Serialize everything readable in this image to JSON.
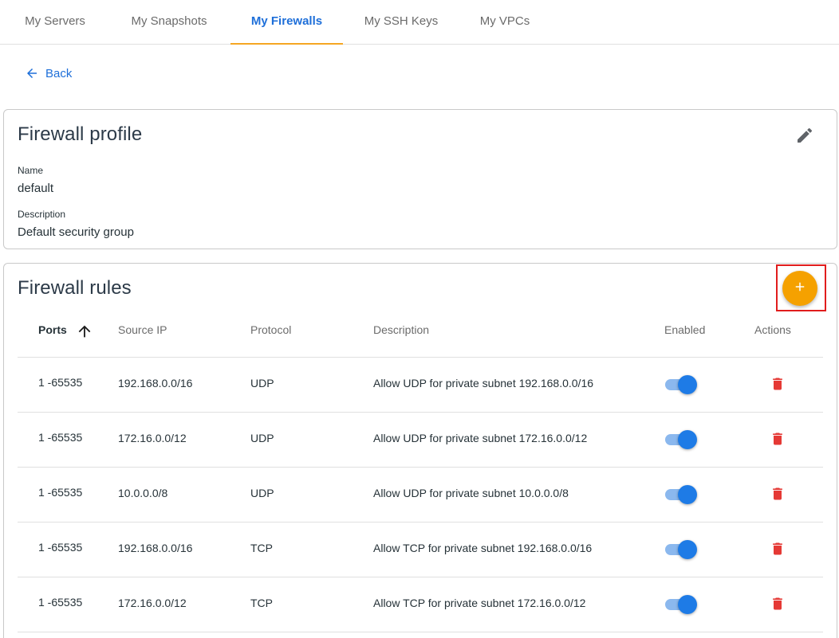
{
  "tabs": [
    {
      "label": "My Servers",
      "active": false
    },
    {
      "label": "My Snapshots",
      "active": false
    },
    {
      "label": "My Firewalls",
      "active": true
    },
    {
      "label": "My SSH Keys",
      "active": false
    },
    {
      "label": "My VPCs",
      "active": false
    }
  ],
  "back": {
    "label": "Back",
    "icon": "arrow-left-icon"
  },
  "profile": {
    "title": "Firewall profile",
    "edit_icon": "pencil-icon",
    "name_label": "Name",
    "name_value": "default",
    "description_label": "Description",
    "description_value": "Default security group"
  },
  "rules": {
    "title": "Firewall rules",
    "add_icon": "plus-icon",
    "columns": {
      "ports": "Ports",
      "source_ip": "Source IP",
      "protocol": "Protocol",
      "description": "Description",
      "enabled": "Enabled",
      "actions": "Actions"
    },
    "sort": {
      "column": "ports",
      "direction": "ascending",
      "icon": "arrow-up-icon"
    },
    "rows": [
      {
        "ports": "1 -65535",
        "source_ip": "192.168.0.0/16",
        "protocol": "UDP",
        "description": "Allow UDP for private subnet 192.168.0.0/16",
        "enabled": true
      },
      {
        "ports": "1 -65535",
        "source_ip": "172.16.0.0/12",
        "protocol": "UDP",
        "description": "Allow UDP for private subnet 172.16.0.0/12",
        "enabled": true
      },
      {
        "ports": "1 -65535",
        "source_ip": "10.0.0.0/8",
        "protocol": "UDP",
        "description": "Allow UDP for private subnet 10.0.0.0/8",
        "enabled": true
      },
      {
        "ports": "1 -65535",
        "source_ip": "192.168.0.0/16",
        "protocol": "TCP",
        "description": "Allow TCP for private subnet 192.168.0.0/16",
        "enabled": true
      },
      {
        "ports": "1 -65535",
        "source_ip": "172.16.0.0/12",
        "protocol": "TCP",
        "description": "Allow TCP for private subnet 172.16.0.0/12",
        "enabled": true
      }
    ],
    "delete_icon": "trash-icon"
  },
  "colors": {
    "accent_blue": "#1e6fd9",
    "tab_underline": "#f5a623",
    "add_button": "#f5a100",
    "highlight_border": "#e11d1d",
    "toggle_knob": "#1e7be6",
    "toggle_track": "#8bb8ee",
    "delete_red": "#e53935"
  }
}
